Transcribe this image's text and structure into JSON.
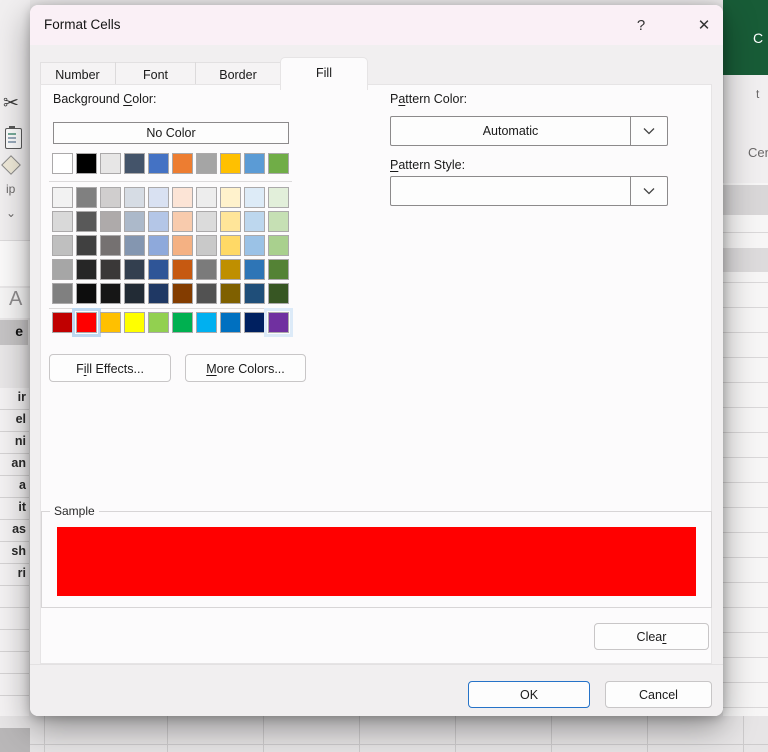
{
  "window": {
    "title": "Format Cells",
    "help_button": "?",
    "close_button": "✕"
  },
  "tabs": {
    "items": [
      "Number",
      "Font",
      "Border",
      "Fill"
    ],
    "active": "Fill"
  },
  "fill_tab": {
    "background_color_label": {
      "pre": "Background ",
      "accel": "C",
      "post": "olor:"
    },
    "no_color_button": "No Color",
    "pattern_color_label": {
      "pre": "P",
      "accel": "a",
      "post": "ttern Color:"
    },
    "pattern_color_value": "Automatic",
    "pattern_style_label": {
      "pre": "",
      "accel": "P",
      "post": "attern Style:"
    },
    "pattern_style_value": "",
    "fill_effects_button": {
      "pre": "F",
      "accel": "i",
      "post": "ll Effects..."
    },
    "more_colors_button": {
      "pre": "",
      "accel": "M",
      "post": "ore Colors..."
    },
    "sample_label": "Sample",
    "sample_fill_color": "#FF0000",
    "clear_button": {
      "pre": "Clea",
      "accel": "r",
      "post": ""
    }
  },
  "footer": {
    "ok_button": "OK",
    "cancel_button": "Cancel"
  },
  "palette": {
    "theme_colors": [
      "#FFFFFF",
      "#000000",
      "#E7E6E6",
      "#44546A",
      "#4472C4",
      "#ED7D31",
      "#A5A5A5",
      "#FFC000",
      "#5B9BD5",
      "#70AD47"
    ],
    "tint_rows": [
      [
        "#F2F2F2",
        "#808080",
        "#D0CECE",
        "#D6DCE4",
        "#D9E1F2",
        "#FCE4D6",
        "#EDEDED",
        "#FFF2CC",
        "#DDEBF7",
        "#E2EFDA"
      ],
      [
        "#D9D9D9",
        "#595959",
        "#AEAAAA",
        "#ACB9CA",
        "#B4C6E7",
        "#F8CBAD",
        "#DBDBDB",
        "#FFE599",
        "#BDD7EE",
        "#C6E0B4"
      ],
      [
        "#BFBFBF",
        "#404040",
        "#757171",
        "#8496B0",
        "#8EA9DB",
        "#F4B183",
        "#C9C9C9",
        "#FFD966",
        "#9BC2E6",
        "#A9D08E"
      ],
      [
        "#A6A6A6",
        "#262626",
        "#3A3838",
        "#333F4F",
        "#2F5597",
        "#C65911",
        "#7B7B7B",
        "#BF8F00",
        "#2E75B6",
        "#548235"
      ],
      [
        "#808080",
        "#0D0D0D",
        "#161616",
        "#222B35",
        "#1F3864",
        "#833C00",
        "#525252",
        "#7F6000",
        "#1F4E79",
        "#375623"
      ]
    ],
    "standard_colors": [
      "#C00000",
      "#FF0000",
      "#FFC000",
      "#FFFF00",
      "#92D050",
      "#00B050",
      "#00B0F0",
      "#0070C0",
      "#002060",
      "#7030A0"
    ],
    "standard_selected_index": 1,
    "standard_focused_index": 9,
    "selected_color": "#FF0000",
    "selection_ring_color": "#BDD8F1"
  },
  "excel_background": {
    "titlebar_color": "#185C37",
    "titlebar_fragment": "C",
    "ribbon_group_fragment": "ip",
    "ribbon_chevron": "⌄",
    "scissors_glyph": "✂",
    "right_fragment_top": "t",
    "right_fragment_group": "Cent",
    "column_letter_fragment": "A",
    "selected_cell_fragment": "e",
    "left_cell_fragments": [
      "ir",
      "el",
      "ni",
      "an",
      "a",
      "it",
      "as",
      "sh",
      "ri"
    ]
  }
}
